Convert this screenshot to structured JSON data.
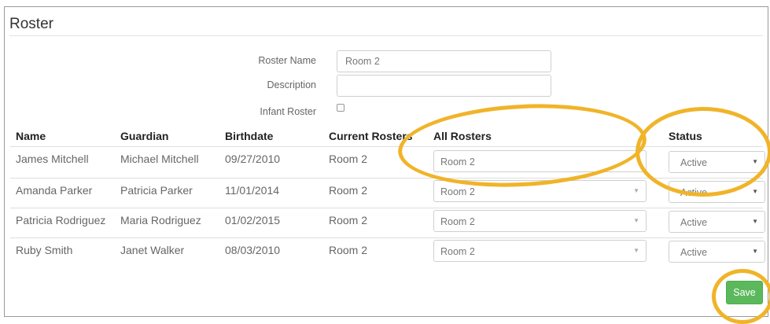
{
  "page": {
    "title": "Roster"
  },
  "form": {
    "roster_name_label": "Roster Name",
    "roster_name_value": "Room 2",
    "description_label": "Description",
    "description_value": "",
    "infant_label": "Infant Roster",
    "infant_checked": false
  },
  "table": {
    "headers": {
      "name": "Name",
      "guardian": "Guardian",
      "birthdate": "Birthdate",
      "current_rosters": "Current Rosters",
      "all_rosters": "All Rosters",
      "status": "Status"
    },
    "rows": [
      {
        "name": "James Mitchell",
        "guardian": "Michael Mitchell",
        "birthdate": "09/27/2010",
        "current": "Room 2",
        "all_rosters": "Room 2",
        "status": "Active"
      },
      {
        "name": "Amanda Parker",
        "guardian": "Patricia Parker",
        "birthdate": "11/01/2014",
        "current": "Room 2",
        "all_rosters": "Room 2",
        "status": "Active"
      },
      {
        "name": "Patricia Rodriguez",
        "guardian": "Maria Rodriguez",
        "birthdate": "01/02/2015",
        "current": "Room 2",
        "all_rosters": "Room 2",
        "status": "Active"
      },
      {
        "name": "Ruby Smith",
        "guardian": "Janet Walker",
        "birthdate": "08/03/2010",
        "current": "Room 2",
        "all_rosters": "Room 2",
        "status": "Active"
      }
    ]
  },
  "actions": {
    "save_label": "Save"
  },
  "colors": {
    "accent": "#5cb85c",
    "highlight": "#f0b429"
  }
}
